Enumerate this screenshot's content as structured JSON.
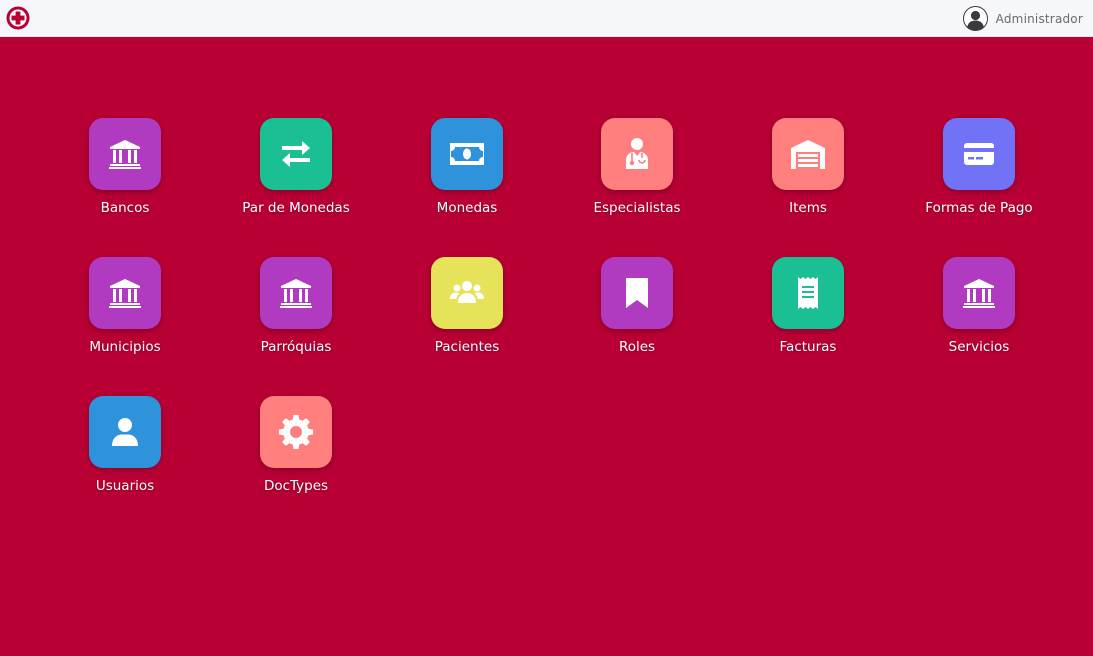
{
  "user": {
    "name": "Administrador"
  },
  "modules": [
    {
      "label": "Bancos",
      "icon": "bank-icon",
      "color": "#b03bc1"
    },
    {
      "label": "Par de Monedas",
      "icon": "exchange-arrows-icon",
      "color": "#1bbf94"
    },
    {
      "label": "Monedas",
      "icon": "money-bill-icon",
      "color": "#2f93db"
    },
    {
      "label": "Especialistas",
      "icon": "doctor-icon",
      "color": "#ff7f7f"
    },
    {
      "label": "Items",
      "icon": "warehouse-icon",
      "color": "#ff7f7f"
    },
    {
      "label": "Formas de Pago",
      "icon": "credit-card-icon",
      "color": "#7272f7"
    },
    {
      "label": "Municipios",
      "icon": "bank-icon",
      "color": "#b03bc1"
    },
    {
      "label": "Parróquias",
      "icon": "bank-icon",
      "color": "#b03bc1"
    },
    {
      "label": "Pacientes",
      "icon": "users-icon",
      "color": "#e6e35b"
    },
    {
      "label": "Roles",
      "icon": "bookmark-icon",
      "color": "#b03bc1"
    },
    {
      "label": "Facturas",
      "icon": "receipt-icon",
      "color": "#1bbf94"
    },
    {
      "label": "Servicios",
      "icon": "bank-icon",
      "color": "#b03bc1"
    },
    {
      "label": "Usuarios",
      "icon": "user-icon",
      "color": "#2f93db"
    },
    {
      "label": "DocTypes",
      "icon": "gear-icon",
      "color": "#ff7f7f"
    }
  ]
}
